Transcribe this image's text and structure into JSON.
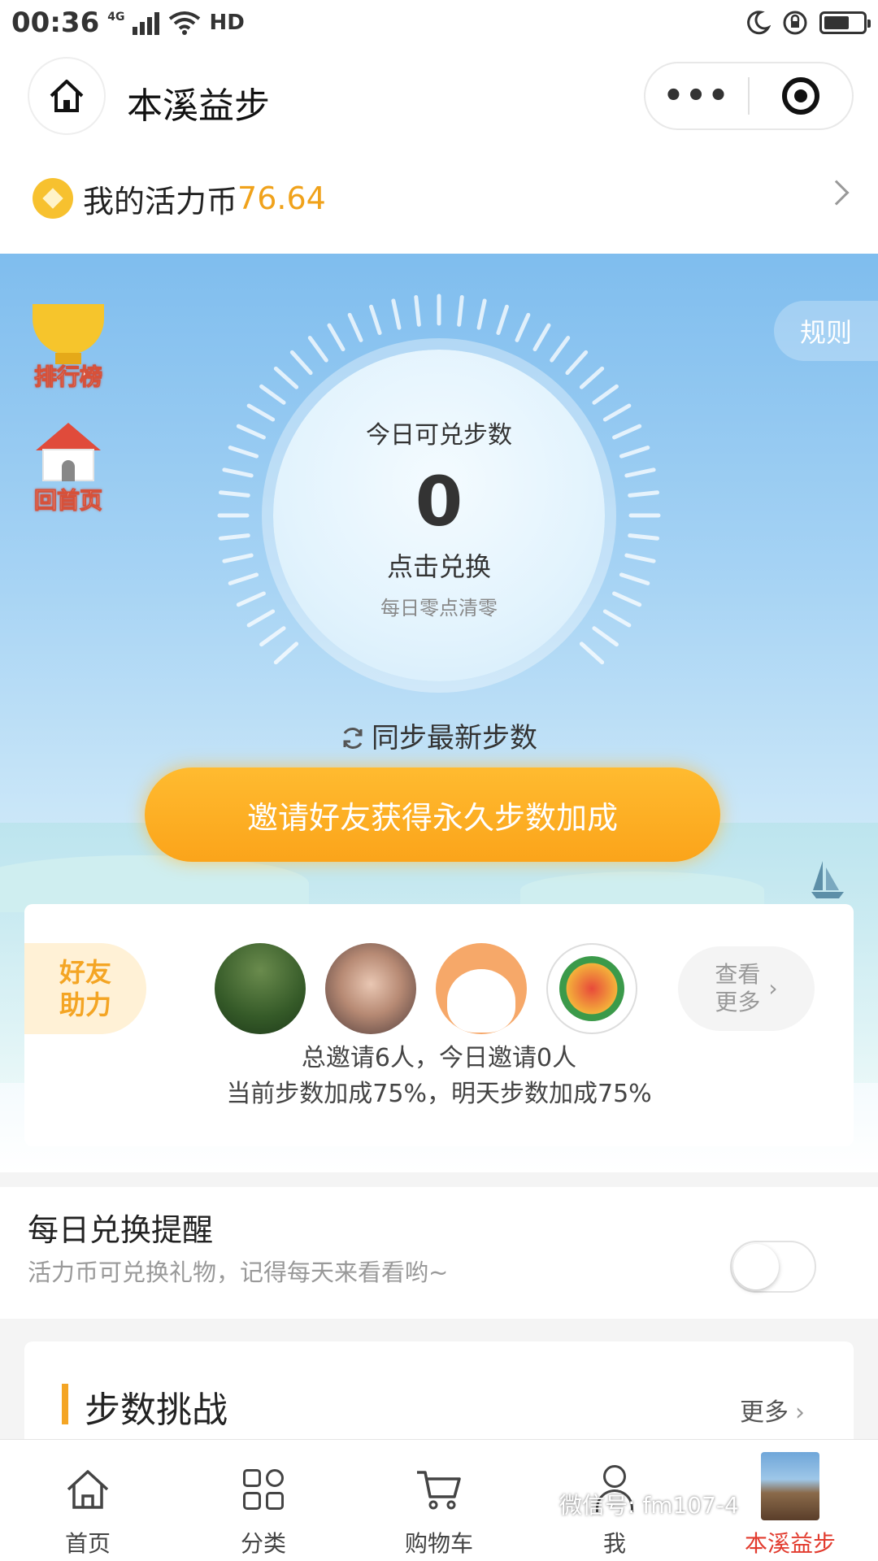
{
  "status_bar": {
    "time": "00:36",
    "network": "4G",
    "hd": "HD"
  },
  "nav": {
    "title": "本溪益步",
    "more_label": "•••"
  },
  "coins": {
    "label": "我的活力币",
    "value": "76.64"
  },
  "hero": {
    "rules_label": "规则",
    "leaderboard_label": "排行榜",
    "home_label": "回首页",
    "steps_title": "今日可兑步数",
    "steps_value": "0",
    "exchange_label": "点击兑换",
    "reset_note": "每日零点清零",
    "sync_label": "同步最新步数",
    "invite_button": "邀请好友获得永久步数加成"
  },
  "friends": {
    "ribbon_line1": "好友",
    "ribbon_line2": "助力",
    "see_more_line1": "查看",
    "see_more_line2": "更多",
    "summary": "总邀请6人，今日邀请0人",
    "bonus": "当前步数加成75%，明天步数加成75%"
  },
  "reminder": {
    "title": "每日兑换提醒",
    "description": "活力币可兑换礼物，记得每天来看看哟~",
    "enabled": false
  },
  "challenge": {
    "title": "步数挑战",
    "more_label": "更多"
  },
  "tabs": [
    {
      "label": "首页",
      "icon": "home-icon"
    },
    {
      "label": "分类",
      "icon": "category-icon"
    },
    {
      "label": "购物车",
      "icon": "cart-icon"
    },
    {
      "label": "我",
      "icon": "user-icon"
    },
    {
      "label": "本溪益步",
      "icon": "mini-program-thumbnail",
      "active": true
    }
  ],
  "watermark": "微信号: fm107-4",
  "colors": {
    "accent_orange": "#fba41a",
    "coin_text": "#f0a21b",
    "active_tab": "#e23b2e"
  }
}
